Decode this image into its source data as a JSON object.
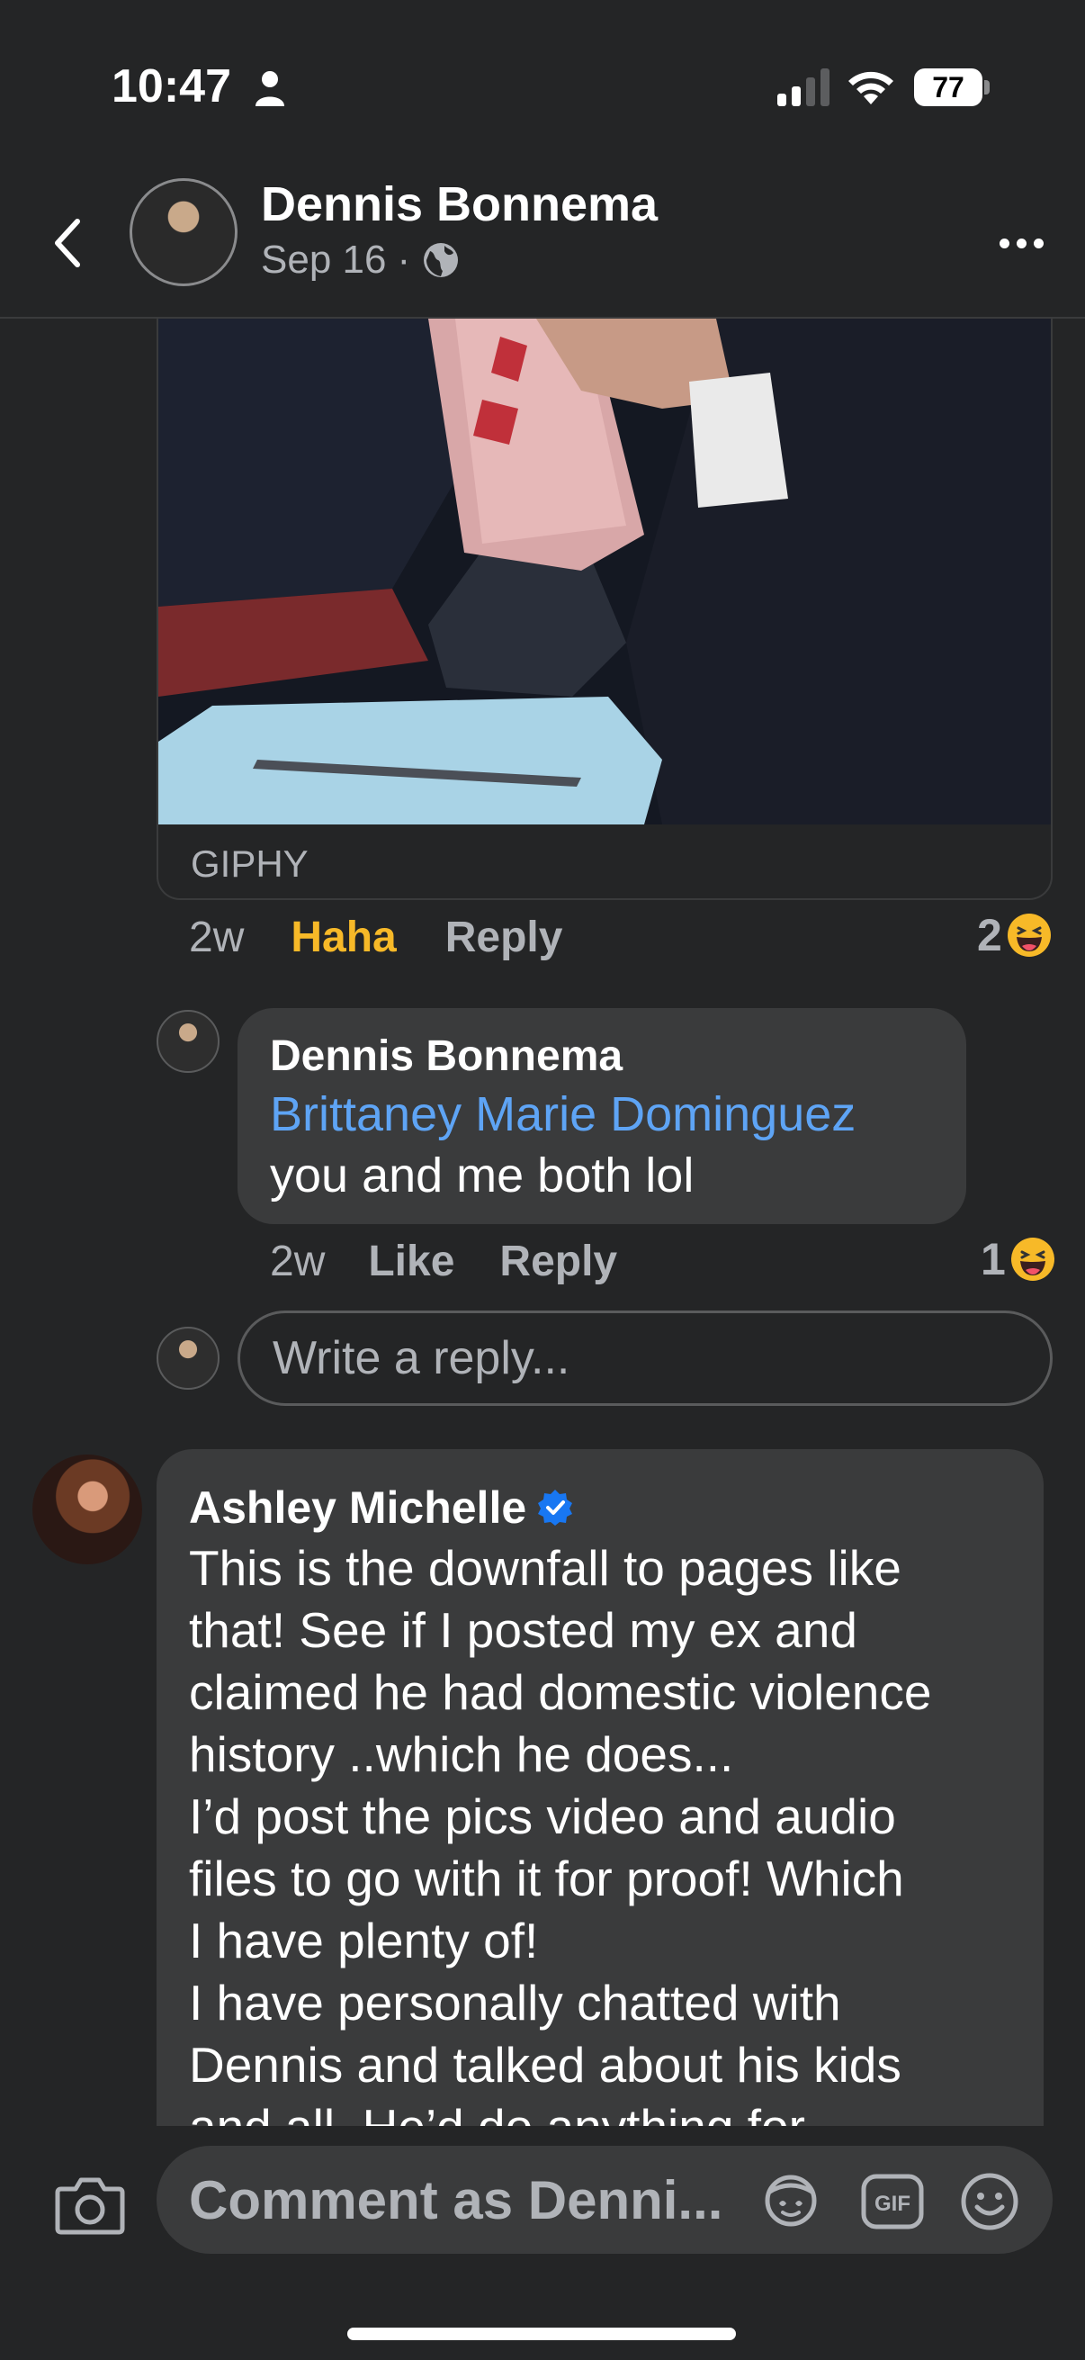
{
  "status_bar": {
    "time": "10:47",
    "battery": "77"
  },
  "header": {
    "name": "Dennis Bonnema",
    "date": "Sep 16",
    "separator": "·"
  },
  "gif_comment": {
    "source": "GIPHY",
    "time_ago": "2w",
    "reaction_label": "Haha",
    "reply_label": "Reply",
    "reaction_count": "2"
  },
  "reply": {
    "author": "Dennis Bonnema",
    "mention": "Brittaney Marie Dominguez",
    "text": "you and me both lol",
    "time_ago": "2w",
    "like_label": "Like",
    "reply_label": "Reply",
    "reaction_count": "1"
  },
  "write_reply": {
    "placeholder": "Write a reply..."
  },
  "comment": {
    "author": "Ashley Michelle",
    "lines": [
      "This is the downfall to pages like",
      "that! See if I posted my ex and",
      "claimed he had domestic violence",
      "history ..which he does...",
      "I’d post the pics video and audio",
      "files to go with it for proof! Which",
      "I have plenty of!",
      "I have personally chatted with",
      "Dennis and talked about his kids",
      "and all. He’d do anything for"
    ]
  },
  "composer": {
    "placeholder": "Comment as Denni..."
  },
  "colors": {
    "background": "#242526",
    "bubble": "#3a3b3c",
    "haha": "#f7b928",
    "mention": "#5ea4f5",
    "verified": "#1877f2"
  }
}
